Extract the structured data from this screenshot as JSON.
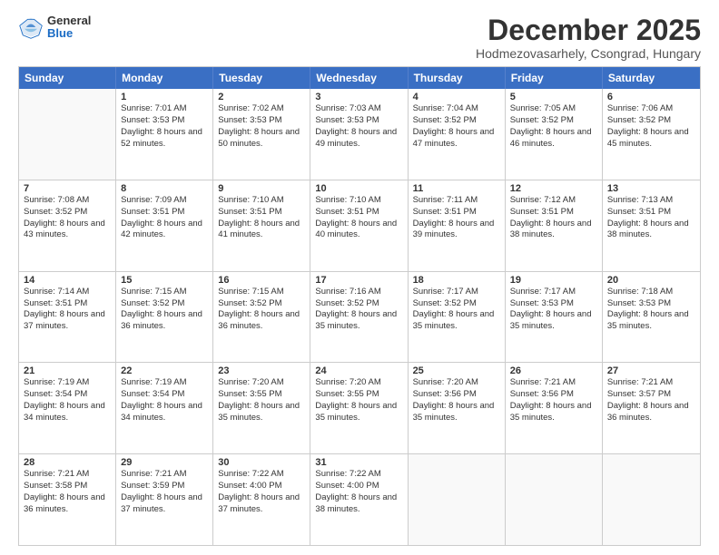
{
  "logo": {
    "general": "General",
    "blue": "Blue"
  },
  "header": {
    "month": "December 2025",
    "location": "Hodmezovasarhely, Csongrad, Hungary"
  },
  "weekdays": [
    "Sunday",
    "Monday",
    "Tuesday",
    "Wednesday",
    "Thursday",
    "Friday",
    "Saturday"
  ],
  "weeks": [
    [
      {
        "day": "",
        "sunrise": "",
        "sunset": "",
        "daylight": ""
      },
      {
        "day": "1",
        "sunrise": "Sunrise: 7:01 AM",
        "sunset": "Sunset: 3:53 PM",
        "daylight": "Daylight: 8 hours and 52 minutes."
      },
      {
        "day": "2",
        "sunrise": "Sunrise: 7:02 AM",
        "sunset": "Sunset: 3:53 PM",
        "daylight": "Daylight: 8 hours and 50 minutes."
      },
      {
        "day": "3",
        "sunrise": "Sunrise: 7:03 AM",
        "sunset": "Sunset: 3:53 PM",
        "daylight": "Daylight: 8 hours and 49 minutes."
      },
      {
        "day": "4",
        "sunrise": "Sunrise: 7:04 AM",
        "sunset": "Sunset: 3:52 PM",
        "daylight": "Daylight: 8 hours and 47 minutes."
      },
      {
        "day": "5",
        "sunrise": "Sunrise: 7:05 AM",
        "sunset": "Sunset: 3:52 PM",
        "daylight": "Daylight: 8 hours and 46 minutes."
      },
      {
        "day": "6",
        "sunrise": "Sunrise: 7:06 AM",
        "sunset": "Sunset: 3:52 PM",
        "daylight": "Daylight: 8 hours and 45 minutes."
      }
    ],
    [
      {
        "day": "7",
        "sunrise": "Sunrise: 7:08 AM",
        "sunset": "Sunset: 3:52 PM",
        "daylight": "Daylight: 8 hours and 43 minutes."
      },
      {
        "day": "8",
        "sunrise": "Sunrise: 7:09 AM",
        "sunset": "Sunset: 3:51 PM",
        "daylight": "Daylight: 8 hours and 42 minutes."
      },
      {
        "day": "9",
        "sunrise": "Sunrise: 7:10 AM",
        "sunset": "Sunset: 3:51 PM",
        "daylight": "Daylight: 8 hours and 41 minutes."
      },
      {
        "day": "10",
        "sunrise": "Sunrise: 7:10 AM",
        "sunset": "Sunset: 3:51 PM",
        "daylight": "Daylight: 8 hours and 40 minutes."
      },
      {
        "day": "11",
        "sunrise": "Sunrise: 7:11 AM",
        "sunset": "Sunset: 3:51 PM",
        "daylight": "Daylight: 8 hours and 39 minutes."
      },
      {
        "day": "12",
        "sunrise": "Sunrise: 7:12 AM",
        "sunset": "Sunset: 3:51 PM",
        "daylight": "Daylight: 8 hours and 38 minutes."
      },
      {
        "day": "13",
        "sunrise": "Sunrise: 7:13 AM",
        "sunset": "Sunset: 3:51 PM",
        "daylight": "Daylight: 8 hours and 38 minutes."
      }
    ],
    [
      {
        "day": "14",
        "sunrise": "Sunrise: 7:14 AM",
        "sunset": "Sunset: 3:51 PM",
        "daylight": "Daylight: 8 hours and 37 minutes."
      },
      {
        "day": "15",
        "sunrise": "Sunrise: 7:15 AM",
        "sunset": "Sunset: 3:52 PM",
        "daylight": "Daylight: 8 hours and 36 minutes."
      },
      {
        "day": "16",
        "sunrise": "Sunrise: 7:15 AM",
        "sunset": "Sunset: 3:52 PM",
        "daylight": "Daylight: 8 hours and 36 minutes."
      },
      {
        "day": "17",
        "sunrise": "Sunrise: 7:16 AM",
        "sunset": "Sunset: 3:52 PM",
        "daylight": "Daylight: 8 hours and 35 minutes."
      },
      {
        "day": "18",
        "sunrise": "Sunrise: 7:17 AM",
        "sunset": "Sunset: 3:52 PM",
        "daylight": "Daylight: 8 hours and 35 minutes."
      },
      {
        "day": "19",
        "sunrise": "Sunrise: 7:17 AM",
        "sunset": "Sunset: 3:53 PM",
        "daylight": "Daylight: 8 hours and 35 minutes."
      },
      {
        "day": "20",
        "sunrise": "Sunrise: 7:18 AM",
        "sunset": "Sunset: 3:53 PM",
        "daylight": "Daylight: 8 hours and 35 minutes."
      }
    ],
    [
      {
        "day": "21",
        "sunrise": "Sunrise: 7:19 AM",
        "sunset": "Sunset: 3:54 PM",
        "daylight": "Daylight: 8 hours and 34 minutes."
      },
      {
        "day": "22",
        "sunrise": "Sunrise: 7:19 AM",
        "sunset": "Sunset: 3:54 PM",
        "daylight": "Daylight: 8 hours and 34 minutes."
      },
      {
        "day": "23",
        "sunrise": "Sunrise: 7:20 AM",
        "sunset": "Sunset: 3:55 PM",
        "daylight": "Daylight: 8 hours and 35 minutes."
      },
      {
        "day": "24",
        "sunrise": "Sunrise: 7:20 AM",
        "sunset": "Sunset: 3:55 PM",
        "daylight": "Daylight: 8 hours and 35 minutes."
      },
      {
        "day": "25",
        "sunrise": "Sunrise: 7:20 AM",
        "sunset": "Sunset: 3:56 PM",
        "daylight": "Daylight: 8 hours and 35 minutes."
      },
      {
        "day": "26",
        "sunrise": "Sunrise: 7:21 AM",
        "sunset": "Sunset: 3:56 PM",
        "daylight": "Daylight: 8 hours and 35 minutes."
      },
      {
        "day": "27",
        "sunrise": "Sunrise: 7:21 AM",
        "sunset": "Sunset: 3:57 PM",
        "daylight": "Daylight: 8 hours and 36 minutes."
      }
    ],
    [
      {
        "day": "28",
        "sunrise": "Sunrise: 7:21 AM",
        "sunset": "Sunset: 3:58 PM",
        "daylight": "Daylight: 8 hours and 36 minutes."
      },
      {
        "day": "29",
        "sunrise": "Sunrise: 7:21 AM",
        "sunset": "Sunset: 3:59 PM",
        "daylight": "Daylight: 8 hours and 37 minutes."
      },
      {
        "day": "30",
        "sunrise": "Sunrise: 7:22 AM",
        "sunset": "Sunset: 4:00 PM",
        "daylight": "Daylight: 8 hours and 37 minutes."
      },
      {
        "day": "31",
        "sunrise": "Sunrise: 7:22 AM",
        "sunset": "Sunset: 4:00 PM",
        "daylight": "Daylight: 8 hours and 38 minutes."
      },
      {
        "day": "",
        "sunrise": "",
        "sunset": "",
        "daylight": ""
      },
      {
        "day": "",
        "sunrise": "",
        "sunset": "",
        "daylight": ""
      },
      {
        "day": "",
        "sunrise": "",
        "sunset": "",
        "daylight": ""
      }
    ]
  ]
}
